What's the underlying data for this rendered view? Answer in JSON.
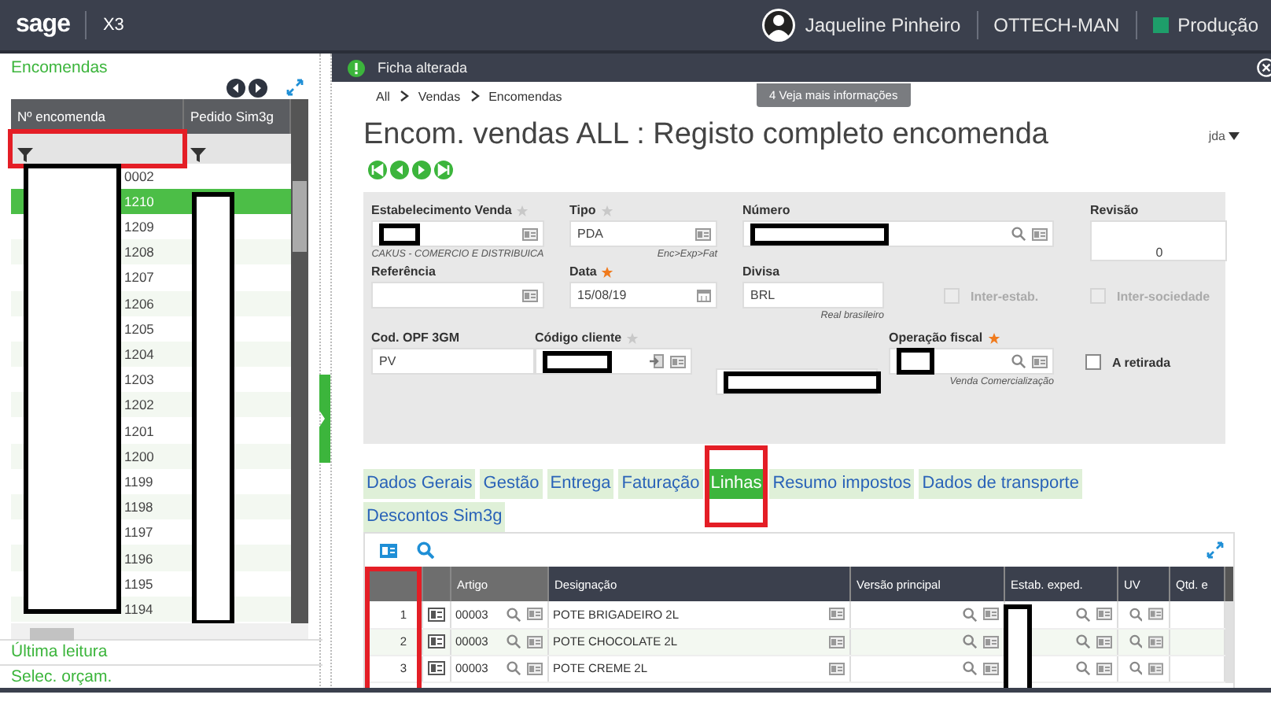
{
  "topbar": {
    "logo": "sage",
    "product": "X3",
    "user": "Jaqueline Pinheiro",
    "folder": "OTTECH-MAN",
    "environment": "Produção"
  },
  "left_panel": {
    "title": "Encomendas",
    "columns": [
      {
        "label": "Nº encomenda",
        "redacted": true,
        "highlighted": true
      },
      {
        "label": "Pedido Sim3g",
        "redacted": true
      }
    ],
    "rows": [
      {
        "number": "0002",
        "selected": false
      },
      {
        "number": "1210",
        "selected": true
      },
      {
        "number": "1209",
        "selected": false
      },
      {
        "number": "1208",
        "selected": false
      },
      {
        "number": "1207",
        "selected": false
      },
      {
        "number": "1206",
        "selected": false
      },
      {
        "number": "1205",
        "selected": false
      },
      {
        "number": "1204",
        "selected": false
      },
      {
        "number": "1203",
        "selected": false
      },
      {
        "number": "1202",
        "selected": false
      },
      {
        "number": "1201",
        "selected": false
      },
      {
        "number": "1200",
        "selected": false
      },
      {
        "number": "1199",
        "selected": false
      },
      {
        "number": "1198",
        "selected": false
      },
      {
        "number": "1197",
        "selected": false
      },
      {
        "number": "1196",
        "selected": false
      },
      {
        "number": "1195",
        "selected": false
      },
      {
        "number": "1194",
        "selected": false
      }
    ],
    "links": [
      "Última leitura",
      "Selec. orçam."
    ]
  },
  "notification": {
    "message": "Ficha alterada",
    "more": "4 Veja mais informações"
  },
  "breadcrumb": [
    "All",
    "Vendas",
    "Encomendas"
  ],
  "page_title": "Encom. vendas ALL : Registo completo encomenda",
  "user_menu": "jda",
  "form": {
    "fields": [
      {
        "kind": "detail",
        "label": "Estabelecimento Venda",
        "starred": true,
        "redacted": true,
        "hint": "CAKUS - COMERCIO E DISTRIBUICA"
      },
      {
        "kind": "detail",
        "label": "Tipo",
        "starred": true,
        "value": "PDA",
        "hint": "Enc>Exp>Fat"
      },
      {
        "kind": "lookup",
        "label": "Número",
        "redacted": true
      },
      {
        "kind": "number",
        "label": "Revisão",
        "value": "0"
      },
      {
        "kind": "detail",
        "label": "Referência"
      },
      {
        "kind": "date",
        "label": "Data",
        "required": true,
        "value": "15/08/19"
      },
      {
        "kind": "plain",
        "label": "Divisa",
        "value": "BRL",
        "hint": "Real brasileiro"
      },
      {
        "kind": "checkbox",
        "label": "Inter-estab.",
        "checked": false,
        "disabled": true
      },
      {
        "kind": "checkbox",
        "label": "Inter-sociedade",
        "checked": false,
        "disabled": true
      },
      {
        "kind": "plain",
        "label": "Cod. OPF 3GM",
        "value": "PV"
      },
      {
        "kind": "client",
        "label": "Código cliente",
        "starred": true,
        "redacted": true
      },
      {
        "kind": "plain",
        "redacted": true
      },
      {
        "kind": "lookup",
        "label": "Operação fiscal",
        "required": true,
        "redacted": true,
        "hint": "Venda Comercialização"
      },
      {
        "kind": "checkbox",
        "label": "A retirada",
        "checked": false,
        "disabled": false
      }
    ]
  },
  "tabs": [
    {
      "label": "Dados Gerais",
      "selected": false
    },
    {
      "label": "Gestão",
      "selected": false
    },
    {
      "label": "Entrega",
      "selected": false
    },
    {
      "label": "Faturação",
      "selected": false
    },
    {
      "label": "Linhas",
      "selected": true,
      "highlighted": true
    },
    {
      "label": "Resumo impostos",
      "selected": false
    },
    {
      "label": "Dados de transporte",
      "selected": false
    },
    {
      "label": "Descontos Sim3g",
      "selected": false
    }
  ],
  "lines_table": {
    "columns": [
      {
        "kind": "index",
        "highlighted": true
      },
      {
        "kind": "action"
      },
      {
        "kind": "article",
        "label": "Artigo"
      },
      {
        "kind": "designation",
        "label": "Designação"
      },
      {
        "kind": "lookup",
        "label": "Versão principal"
      },
      {
        "kind": "lookup",
        "label": "Estab. exped.",
        "redacted": true
      },
      {
        "kind": "lookup",
        "label": "UV"
      },
      {
        "kind": "plain",
        "label": "Qtd. e"
      }
    ],
    "rows": [
      {
        "number": "1",
        "article": "00003",
        "designation": "POTE BRIGADEIRO 2L"
      },
      {
        "number": "2",
        "article": "00003",
        "designation": "POTE CHOCOLATE 2L"
      },
      {
        "number": "3",
        "article": "00003",
        "designation": "POTE CREME 2L"
      }
    ]
  }
}
